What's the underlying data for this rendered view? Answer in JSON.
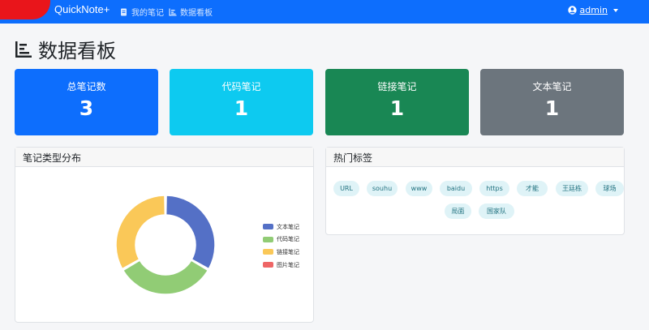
{
  "navbar": {
    "brand": "QuickNote+",
    "links": [
      {
        "label": "我的笔记",
        "icon": "notes-icon"
      },
      {
        "label": "数据看板",
        "icon": "bar-chart-icon"
      }
    ],
    "user": {
      "name": "admin",
      "icon": "user-circle-icon"
    }
  },
  "page": {
    "title": "数据看板",
    "title_icon": "bar-chart-icon"
  },
  "stats": [
    {
      "label": "总笔记数",
      "value": "3",
      "color": "#0d6efd"
    },
    {
      "label": "代码笔记",
      "value": "1",
      "color": "#0dcaf0"
    },
    {
      "label": "链接笔记",
      "value": "1",
      "color": "#198754"
    },
    {
      "label": "文本笔记",
      "value": "1",
      "color": "#6c757d"
    }
  ],
  "distribution": {
    "title": "笔记类型分布",
    "chart_data": {
      "type": "pie",
      "donut": true,
      "categories": [
        "文本笔记",
        "代码笔记",
        "链接笔记",
        "图片笔记"
      ],
      "values": [
        1,
        1,
        1,
        0
      ],
      "colors": [
        "#5470c6",
        "#91cc75",
        "#fac858",
        "#ee6666"
      ],
      "legend_position": "right"
    }
  },
  "tags_card": {
    "title": "热门标签",
    "tags": [
      "URL",
      "souhu",
      "www",
      "baidu",
      "https",
      "才能",
      "王廷栋",
      "球场",
      "局面",
      "国家队"
    ]
  }
}
